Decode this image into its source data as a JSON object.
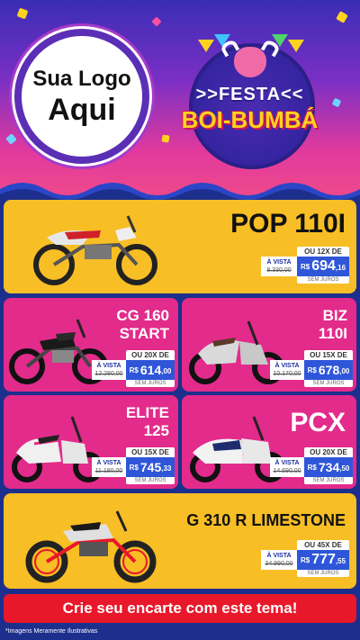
{
  "logo": {
    "line1": "Sua Logo",
    "line2": "Aqui"
  },
  "festa": {
    "title": ">>FESTA<<",
    "subtitle": "BOI-BUMBÁ"
  },
  "colors": {
    "yellow": "#f7be25",
    "pink": "#e22b8b",
    "blue": "#2f56d9",
    "red": "#e8182a"
  },
  "products": [
    {
      "name": "POP 110I",
      "installments": "OU 12X DE",
      "avista": "À VISTA",
      "old_price": "8.330,00",
      "currency": "R$",
      "value": "694",
      "cents": ",16",
      "note": "SEM JUROS"
    },
    {
      "name_line1": "CG 160",
      "name_line2": "START",
      "installments": "OU 20X DE",
      "avista": "À VISTA",
      "old_price": "12.280,00",
      "currency": "R$",
      "value": "614",
      "cents": ",00",
      "note": "SEM JUROS"
    },
    {
      "name_line1": "BIZ",
      "name_line2": "110I",
      "installments": "OU 15X DE",
      "avista": "À VISTA",
      "old_price": "10.170,00",
      "currency": "R$",
      "value": "678",
      "cents": ",00",
      "note": "SEM JUROS"
    },
    {
      "name_line1": "ELITE",
      "name_line2": "125",
      "installments": "OU 15X DE",
      "avista": "À VISTA",
      "old_price": "11.180,00",
      "currency": "R$",
      "value": "745",
      "cents": ",33",
      "note": "SEM JUROS"
    },
    {
      "name": "PCX",
      "installments": "OU 20X DE",
      "avista": "À VISTA",
      "old_price": "14.690,00",
      "currency": "R$",
      "value": "734",
      "cents": ",50",
      "note": "SEM JUROS"
    },
    {
      "name": "G 310 R LIMESTONE",
      "installments": "OU 45X DE",
      "avista": "À VISTA",
      "old_price": "34.990,00",
      "currency": "R$",
      "value": "777",
      "cents": ",55",
      "note": "SEM JUROS"
    }
  ],
  "cta": "Crie seu encarte com este tema!",
  "footnote": "*Imagens Meramente Ilustrativas"
}
